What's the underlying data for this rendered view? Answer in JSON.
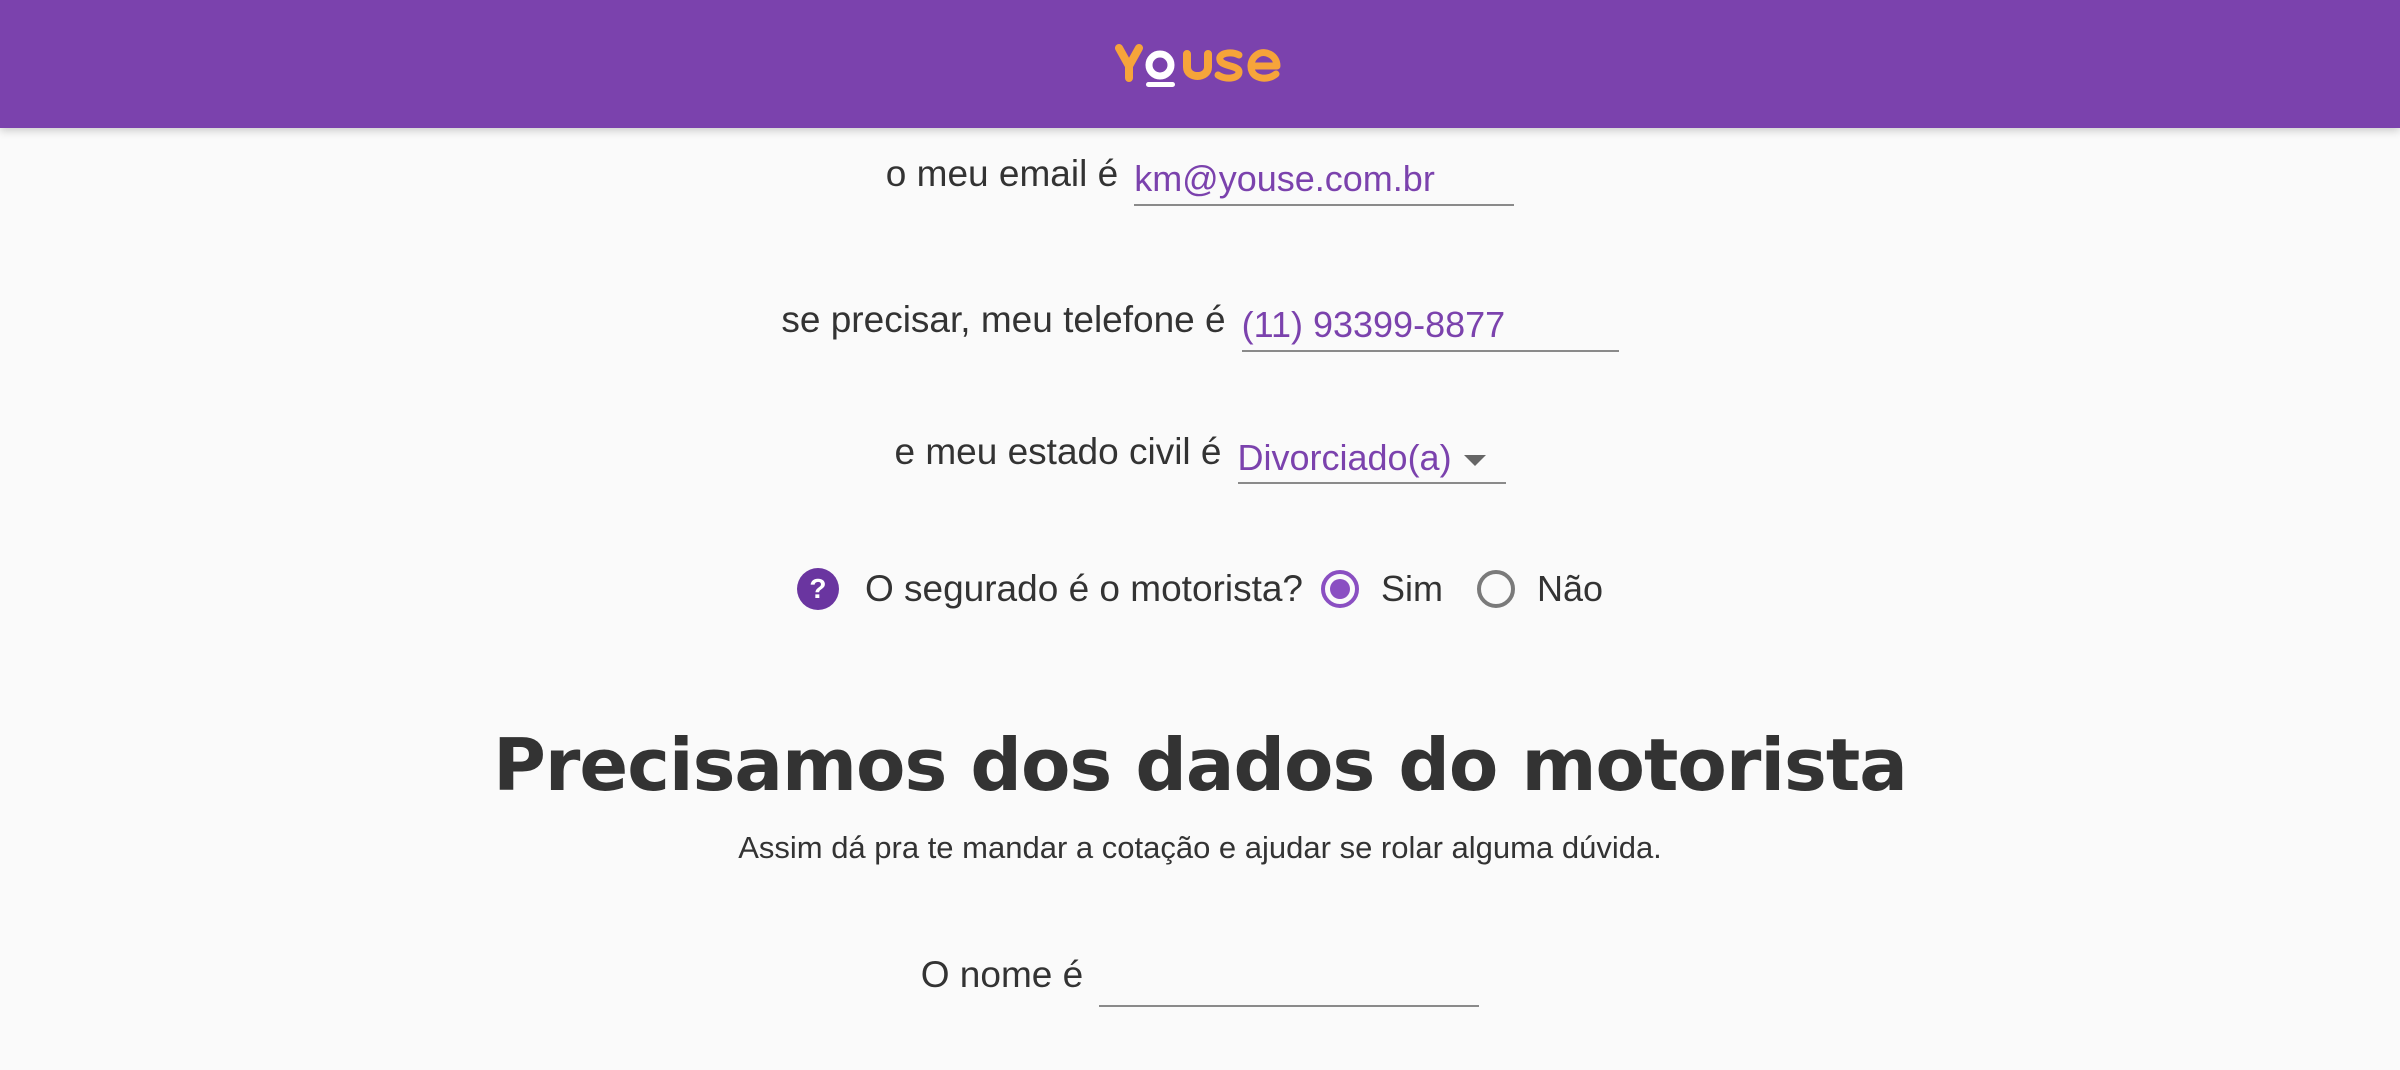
{
  "header": {
    "logo_text": "youse",
    "background_color": "#7b42ad",
    "logo_color": "#f6a43a"
  },
  "form": {
    "email": {
      "label": "o meu email é",
      "value": "km@youse.com.br"
    },
    "phone": {
      "label": "se precisar, meu telefone é",
      "value": "(11) 93399-8877"
    },
    "marital_status": {
      "label": "e meu estado civil é",
      "selected": "Divorciado(a)",
      "icon": "chevron-down-icon"
    },
    "insured_is_driver": {
      "help_icon": "question-icon",
      "help_glyph": "?",
      "question": "O segurado é o motorista?",
      "options": [
        {
          "label": "Sim",
          "checked": true
        },
        {
          "label": "Não",
          "checked": false
        }
      ]
    }
  },
  "driver_section": {
    "title": "Precisamos dos dados do motorista",
    "subtitle": "Assim dá pra te mandar a cotação e ajudar se rolar alguma dúvida.",
    "name": {
      "label": "O nome é",
      "value": ""
    }
  },
  "colors": {
    "accent": "#7b42ad",
    "radio_checked": "#8a4fc2",
    "text": "#333333",
    "page_background": "#fafafa"
  }
}
